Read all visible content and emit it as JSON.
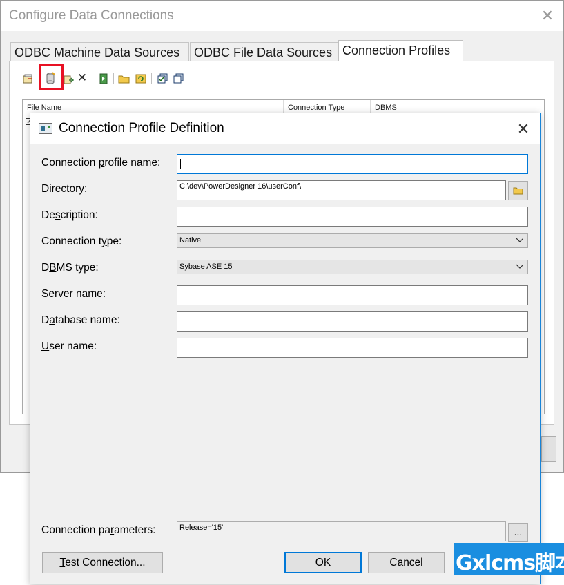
{
  "outer_window": {
    "title": "Configure Data Connections",
    "tabs": [
      "ODBC Machine Data Sources",
      "ODBC File Data Sources",
      "Connection Profiles"
    ],
    "active_tab": "Connection Profiles",
    "toolbar_icons": [
      "properties-icon",
      "add-connection-profile-icon",
      "import-icon",
      "delete-icon",
      "test-connection-icon",
      "open-folder-icon",
      "refresh-icon",
      "select-all-icon",
      "clear-selection-icon"
    ],
    "highlight_color": "#e81123",
    "list_columns": [
      "File Name",
      "Connection Type",
      "DBMS"
    ]
  },
  "dialog": {
    "title": "Connection Profile Definition",
    "fields": {
      "profile_name": {
        "label_pre": "Connection ",
        "label_u": "p",
        "label_post": "rofile name:",
        "value": ""
      },
      "directory": {
        "label_pre": "",
        "label_u": "D",
        "label_post": "irectory:",
        "value": "C:\\dev\\PowerDesigner 16\\userConf\\"
      },
      "description": {
        "label_pre": "De",
        "label_u": "s",
        "label_post": "cription:",
        "value": ""
      },
      "connection_type": {
        "label_pre": "Connection t",
        "label_u": "y",
        "label_post": "pe:",
        "value": "Native"
      },
      "dbms_type": {
        "label_pre": "D",
        "label_u": "B",
        "label_post": "MS type:",
        "value": "Sybase ASE 15"
      },
      "server_name": {
        "label_pre": "",
        "label_u": "S",
        "label_post": "erver name:",
        "value": ""
      },
      "database_name": {
        "label_pre": "D",
        "label_u": "a",
        "label_post": "tabase name:",
        "value": ""
      },
      "user_name": {
        "label_pre": "",
        "label_u": "U",
        "label_post": "ser name:",
        "value": ""
      },
      "connection_parameters": {
        "label_pre": "Connection pa",
        "label_u": "r",
        "label_post": "ameters:",
        "value": "Release='15'"
      }
    },
    "browse_button_label": "...",
    "buttons": {
      "test_pre": "",
      "test_u": "T",
      "test_post": "est Connection...",
      "ok": "OK",
      "cancel": "Cancel"
    },
    "accent_color": "#0078d7"
  },
  "watermark": {
    "text": "Gxlcms脚本"
  }
}
